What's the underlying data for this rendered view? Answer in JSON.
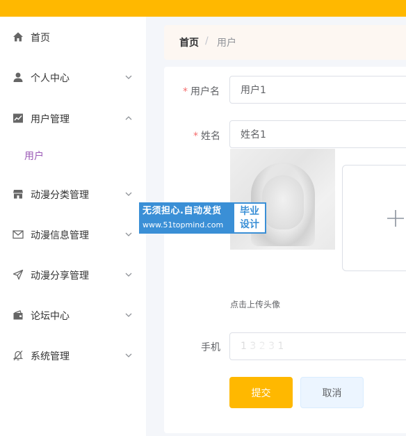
{
  "sidebar": {
    "items": [
      {
        "label": "首页",
        "icon": "home-icon",
        "expandable": false
      },
      {
        "label": "个人中心",
        "icon": "user-icon",
        "expandable": true,
        "expanded": false
      },
      {
        "label": "用户管理",
        "icon": "chart-line-icon",
        "expandable": true,
        "expanded": true
      },
      {
        "label": "动漫分类管理",
        "icon": "shop-icon",
        "expandable": true,
        "expanded": false
      },
      {
        "label": "动漫信息管理",
        "icon": "message-icon",
        "expandable": true,
        "expanded": false
      },
      {
        "label": "动漫分享管理",
        "icon": "send-icon",
        "expandable": true,
        "expanded": false
      },
      {
        "label": "论坛中心",
        "icon": "wallet-icon",
        "expandable": true,
        "expanded": false
      },
      {
        "label": "系统管理",
        "icon": "bell-off-icon",
        "expandable": true,
        "expanded": false
      }
    ],
    "submenu": {
      "label": "用户",
      "active_color": "#9b59b6"
    }
  },
  "breadcrumb": {
    "home": "首页",
    "separator": "/",
    "current": "用户"
  },
  "form": {
    "username": {
      "label": "用户名",
      "required": true,
      "value": "用户1"
    },
    "name": {
      "label": "姓名",
      "required": true,
      "value": "姓名1"
    },
    "avatar": {
      "upload_tip": "点击上传头像"
    },
    "phone": {
      "label": "手机",
      "value": "1 3 2 3 1"
    },
    "submit_label": "提交",
    "cancel_label": "取消"
  },
  "watermark": {
    "slogan": "无须担心.自动发货",
    "url": "www.51topmind.com",
    "badge_line1": "毕业",
    "badge_line2": "设计"
  },
  "colors": {
    "accent": "#ffb800",
    "active_submenu": "#9b59b6",
    "required_asterisk": "#f56c6c",
    "watermark_blue": "#3a8fd6"
  }
}
